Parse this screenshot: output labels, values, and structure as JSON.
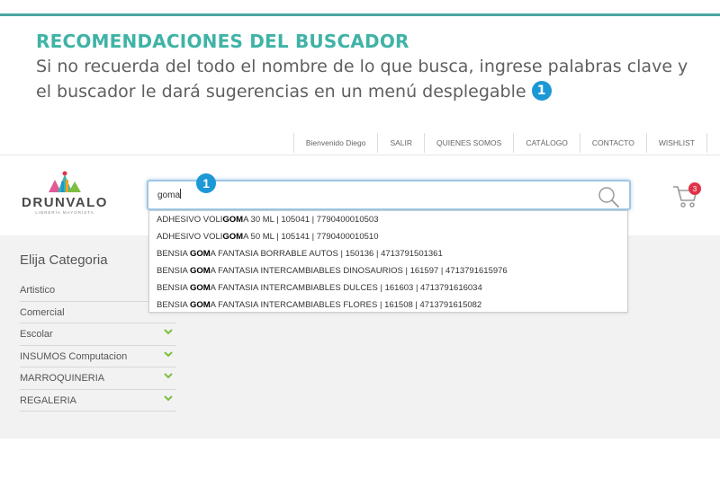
{
  "instructions": {
    "title": "RECOMENDACIONES DEL BUSCADOR",
    "description": "Si no recuerda del todo el nombre de lo que busca, ingrese palabras clave y el buscador le dará sugerencias en un menú desplegable",
    "step_badge": "1"
  },
  "top_nav": {
    "items": [
      "Bienvenido Diego",
      "SALIR",
      "QUIENES SOMOS",
      "CATÁLOGO",
      "CONTACTO",
      "WISHLIST"
    ]
  },
  "logo": {
    "name": "DRUNVALO",
    "tagline": "LIBRERÍA MAYORISTA"
  },
  "search": {
    "value": "goma",
    "callout_number": "1",
    "icon": "search-icon",
    "suggestions": [
      {
        "before": "ADHESIVO VOLI",
        "match": "GOM",
        "after": "A 30 ML | 105041 | 7790400010503"
      },
      {
        "before": "ADHESIVO VOLI",
        "match": "GOM",
        "after": "A 50 ML | 105141 | 7790400010510"
      },
      {
        "before": "BENSIA ",
        "match": "GOM",
        "after": "A FANTASIA BORRABLE AUTOS | 150136 | 4713791501361"
      },
      {
        "before": "BENSIA ",
        "match": "GOM",
        "after": "A FANTASIA INTERCAMBIABLES DINOSAURIOS | 161597 | 4713791615976"
      },
      {
        "before": "BENSIA ",
        "match": "GOM",
        "after": "A FANTASIA INTERCAMBIABLES DULCES | 161603 | 4713791616034"
      },
      {
        "before": "BENSIA ",
        "match": "GOM",
        "after": "A FANTASIA INTERCAMBIABLES FLORES | 161508 | 4713791615082"
      }
    ]
  },
  "cart": {
    "count": "3",
    "icon": "cart-icon"
  },
  "categories": {
    "title": "Elija Categoria",
    "items": [
      {
        "label": "Artistico",
        "has_children": false
      },
      {
        "label": "Comercial",
        "has_children": false
      },
      {
        "label": "Escolar",
        "has_children": true
      },
      {
        "label": "INSUMOS Computacion",
        "has_children": true
      },
      {
        "label": "MARROQUINERIA",
        "has_children": true
      },
      {
        "label": "REGALERIA",
        "has_children": true
      }
    ]
  },
  "colors": {
    "accent_teal": "#3fb3a6",
    "badge_blue": "#1b98d5",
    "cart_badge_red": "#e0334a",
    "chevron_green": "#7cbf3f"
  }
}
